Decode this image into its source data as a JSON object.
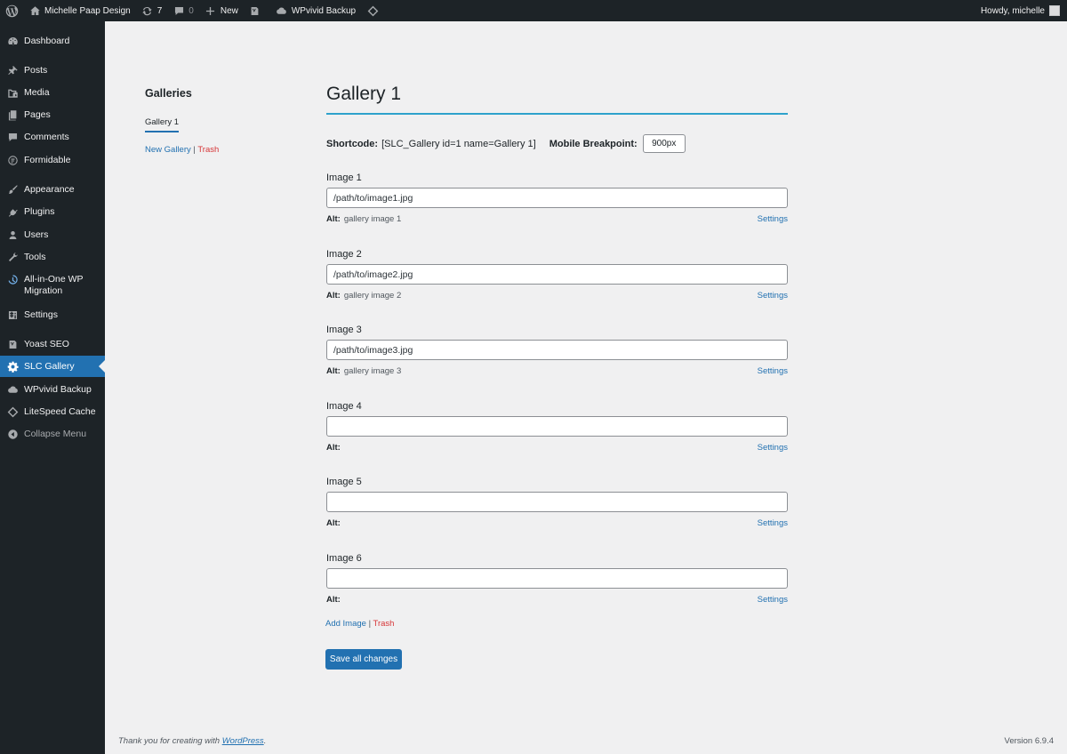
{
  "adminbar": {
    "site_name": "Michelle Paap Design",
    "updates_count": "7",
    "comments_count": "0",
    "new_label": "New",
    "wpvivid_label": "WPvivid Backup",
    "howdy": "Howdy, michelle"
  },
  "sidebar": {
    "items": [
      {
        "label": "Dashboard",
        "icon": "dashboard-icon"
      },
      {
        "label": "Posts",
        "icon": "pin-icon"
      },
      {
        "label": "Media",
        "icon": "media-icon"
      },
      {
        "label": "Pages",
        "icon": "pages-icon"
      },
      {
        "label": "Comments",
        "icon": "comment-icon"
      },
      {
        "label": "Formidable",
        "icon": "formidable-icon"
      },
      {
        "label": "Appearance",
        "icon": "brush-icon"
      },
      {
        "label": "Plugins",
        "icon": "plugin-icon"
      },
      {
        "label": "Users",
        "icon": "user-icon"
      },
      {
        "label": "Tools",
        "icon": "wrench-icon"
      },
      {
        "label": "All-in-One WP Migration",
        "icon": "migration-icon"
      },
      {
        "label": "Settings",
        "icon": "settings-icon"
      },
      {
        "label": "Yoast SEO",
        "icon": "yoast-icon"
      },
      {
        "label": "SLC Gallery",
        "icon": "gear-icon"
      },
      {
        "label": "WPvivid Backup",
        "icon": "cloud-icon"
      },
      {
        "label": "LiteSpeed Cache",
        "icon": "diamond-icon"
      },
      {
        "label": "Collapse Menu",
        "icon": "collapse-icon"
      }
    ]
  },
  "galleries": {
    "title": "Galleries",
    "current": "Gallery 1",
    "new_gallery": "New Gallery",
    "separator": "|",
    "trash": "Trash"
  },
  "main": {
    "title": "Gallery 1",
    "shortcode_label": "Shortcode:",
    "shortcode_value": "[SLC_Gallery id=1 name=Gallery 1]",
    "breakpoint_label": "Mobile Breakpoint:",
    "breakpoint_value": "900px",
    "alt_label": "Alt:",
    "settings_label": "Settings",
    "images": [
      {
        "label": "Image 1",
        "path": "/path/to/image1.jpg",
        "alt": "gallery image 1"
      },
      {
        "label": "Image 2",
        "path": "/path/to/image2.jpg",
        "alt": "gallery image 2"
      },
      {
        "label": "Image 3",
        "path": "/path/to/image3.jpg",
        "alt": "gallery image 3"
      },
      {
        "label": "Image 4",
        "path": "",
        "alt": ""
      },
      {
        "label": "Image 5",
        "path": "",
        "alt": ""
      },
      {
        "label": "Image 6",
        "path": "",
        "alt": ""
      }
    ],
    "add_image": "Add Image",
    "separator": "|",
    "trash": "Trash",
    "save_label": "Save all changes"
  },
  "footer": {
    "thanks_prefix": "Thank you for creating with ",
    "wordpress_link": "WordPress",
    "thanks_suffix": ".",
    "version": "Version 6.9.4"
  },
  "colors": {
    "adminbar_bg": "#1d2327",
    "accent": "#2271b1",
    "title_rule": "#2ea2cc",
    "trash": "#d63638",
    "page_bg": "#f0f0f1"
  }
}
